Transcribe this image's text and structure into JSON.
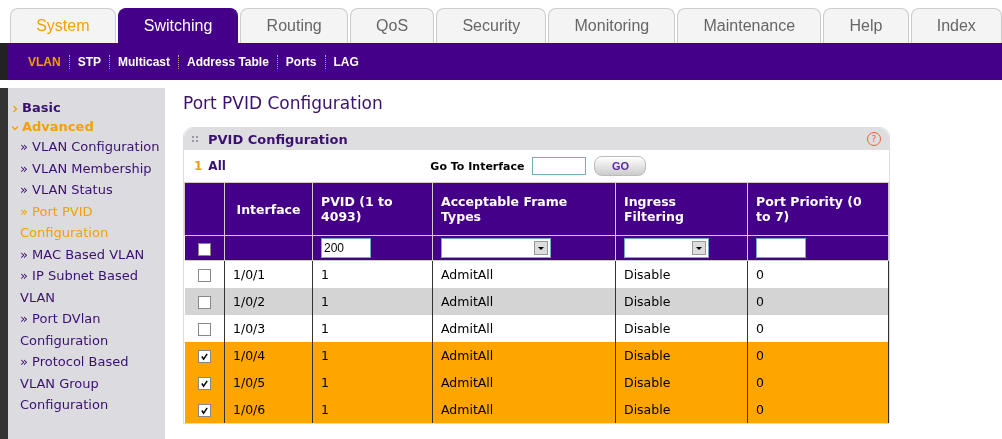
{
  "tabs": [
    {
      "label": "System",
      "selected": false,
      "highlighted": true
    },
    {
      "label": "Switching",
      "selected": true,
      "highlighted": false
    },
    {
      "label": "Routing",
      "selected": false,
      "highlighted": false
    },
    {
      "label": "QoS",
      "selected": false,
      "highlighted": false
    },
    {
      "label": "Security",
      "selected": false,
      "highlighted": false
    },
    {
      "label": "Monitoring",
      "selected": false,
      "highlighted": false
    },
    {
      "label": "Maintenance",
      "selected": false,
      "highlighted": false
    },
    {
      "label": "Help",
      "selected": false,
      "highlighted": false
    },
    {
      "label": "Index",
      "selected": false,
      "highlighted": false
    }
  ],
  "subnav": [
    {
      "label": "VLAN",
      "selected": true
    },
    {
      "label": "STP",
      "selected": false
    },
    {
      "label": "Multicast",
      "selected": false
    },
    {
      "label": "Address Table",
      "selected": false
    },
    {
      "label": "Ports",
      "selected": false
    },
    {
      "label": "LAG",
      "selected": false
    }
  ],
  "sidebar": {
    "items": [
      {
        "label": "Basic",
        "expanded": false
      },
      {
        "label": "Advanced",
        "expanded": true,
        "children": [
          {
            "label": "» VLAN Configuration",
            "selected": false
          },
          {
            "label": "» VLAN Membership",
            "selected": false
          },
          {
            "label": "» VLAN Status",
            "selected": false
          },
          {
            "label": "» Port PVID Configuration",
            "selected": true
          },
          {
            "label": "» MAC Based VLAN",
            "selected": false
          },
          {
            "label": "» IP Subnet Based VLAN",
            "selected": false
          },
          {
            "label": "» Port DVlan Configuration",
            "selected": false
          },
          {
            "label": "» Protocol Based VLAN Group Configuration",
            "selected": false
          }
        ]
      }
    ]
  },
  "page_title": "Port PVID Configuration",
  "panel": {
    "title": "PVID Configuration",
    "help": "?",
    "page_number": "1",
    "page_label": "All",
    "goto_label": "Go To Interface",
    "go_button": "GO"
  },
  "table": {
    "columns": [
      "",
      "Interface",
      "PVID (1 to 4093)",
      "Acceptable Frame Types",
      "Ingress Filtering",
      "Port Priority (0 to 7)"
    ],
    "filter": {
      "checked": false,
      "pvid": "200"
    },
    "rows": [
      {
        "checked": false,
        "interface": "1/0/1",
        "pvid": "1",
        "frame_types": "AdmitAll",
        "ingress": "Disable",
        "priority": "0"
      },
      {
        "checked": false,
        "interface": "1/0/2",
        "pvid": "1",
        "frame_types": "AdmitAll",
        "ingress": "Disable",
        "priority": "0"
      },
      {
        "checked": false,
        "interface": "1/0/3",
        "pvid": "1",
        "frame_types": "AdmitAll",
        "ingress": "Disable",
        "priority": "0"
      },
      {
        "checked": true,
        "interface": "1/0/4",
        "pvid": "1",
        "frame_types": "AdmitAll",
        "ingress": "Disable",
        "priority": "0"
      },
      {
        "checked": true,
        "interface": "1/0/5",
        "pvid": "1",
        "frame_types": "AdmitAll",
        "ingress": "Disable",
        "priority": "0"
      },
      {
        "checked": true,
        "interface": "1/0/6",
        "pvid": "1",
        "frame_types": "AdmitAll",
        "ingress": "Disable",
        "priority": "0"
      }
    ]
  }
}
